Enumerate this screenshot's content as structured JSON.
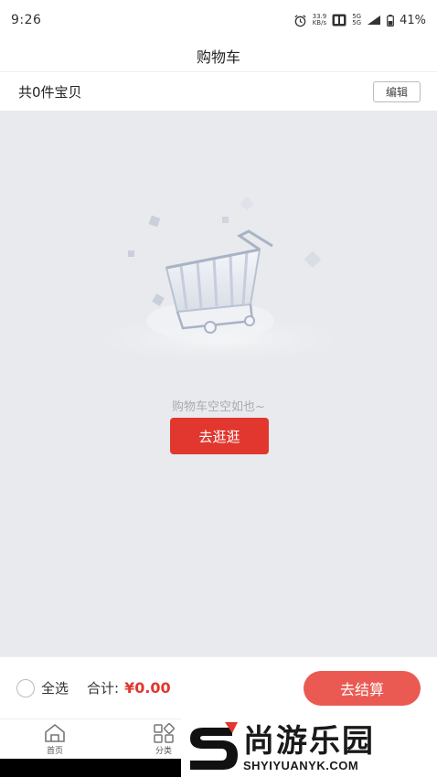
{
  "status_bar": {
    "time": "9:26",
    "net_speed_value": "33.9",
    "net_speed_unit": "KB/s",
    "network_label_1": "5G",
    "network_label_2": "5G",
    "battery": "41%"
  },
  "header": {
    "title": "购物车"
  },
  "cart_summary": {
    "count_text": "共0件宝贝",
    "edit_label": "编辑"
  },
  "empty_state": {
    "message": "购物车空空如也~",
    "button_label": "去逛逛"
  },
  "checkout": {
    "select_all_label": "全选",
    "total_label": "合计:",
    "total_amount": "¥0.00",
    "button_label": "去结算"
  },
  "bottom_nav": {
    "items": [
      {
        "label": "首页",
        "icon": "home-icon"
      },
      {
        "label": "分类",
        "icon": "category-icon"
      }
    ]
  },
  "watermark": {
    "cn_text": "尚游乐园",
    "en_text": "SHYIYUANYK.COM"
  },
  "colors": {
    "accent_red": "#e1372f",
    "checkout_red": "#ea5a52",
    "empty_bg": "#e8eaed"
  }
}
